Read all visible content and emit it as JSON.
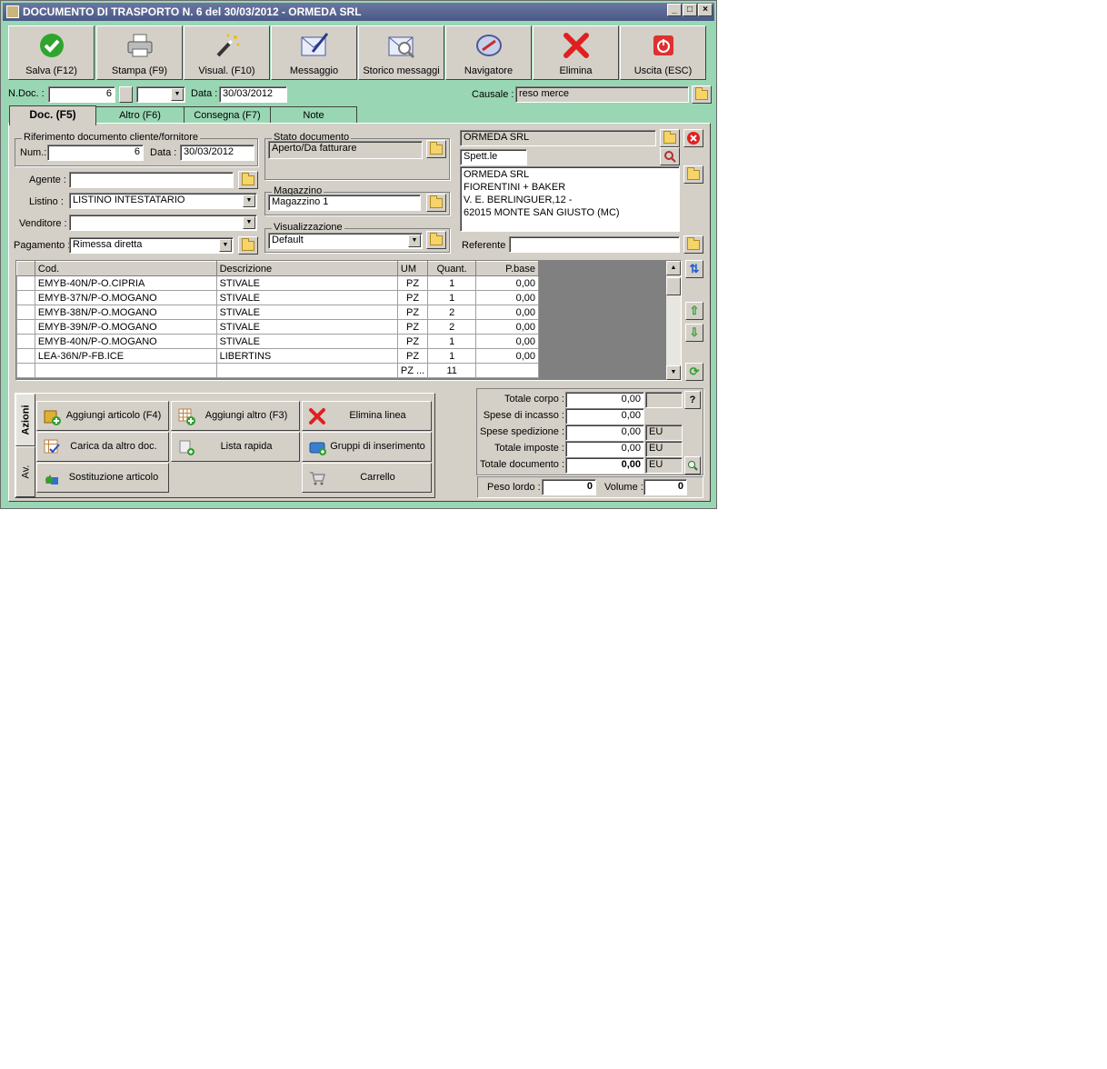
{
  "window": {
    "title": "DOCUMENTO DI TRASPORTO N. 6  del 30/03/2012 - ORMEDA SRL"
  },
  "toolbar": [
    {
      "label": "Salva (F12)",
      "icon": "check-icon"
    },
    {
      "label": "Stampa (F9)",
      "icon": "printer-icon"
    },
    {
      "label": "Visual. (F10)",
      "icon": "magic-wand-icon"
    },
    {
      "label": "Messaggio",
      "icon": "envelope-pen-icon"
    },
    {
      "label": "Storico messaggi",
      "icon": "envelope-search-icon"
    },
    {
      "label": "Navigatore",
      "icon": "compass-icon"
    },
    {
      "label": "Elimina",
      "icon": "red-x-icon"
    },
    {
      "label": "Uscita (ESC)",
      "icon": "power-icon"
    }
  ],
  "header": {
    "ndoc_label": "N.Doc. :",
    "ndoc_value": "6",
    "data_label": "Data :",
    "data_value": "30/03/2012",
    "causale_label": "Causale :",
    "causale_value": "reso merce"
  },
  "tabs": [
    "Doc. (F5)",
    "Altro (F6)",
    "Consegna (F7)",
    "Note"
  ],
  "riferimento": {
    "title": "Riferimento documento cliente/fornitore",
    "num_label": "Num.:",
    "num_value": "6",
    "data_label": "Data :",
    "data_value": "30/03/2012"
  },
  "fields": {
    "agente_label": "Agente :",
    "agente_value": "",
    "listino_label": "Listino :",
    "listino_value": "LISTINO INTESTATARIO",
    "venditore_label": "Venditore :",
    "venditore_value": "",
    "pagamento_label": "Pagamento :",
    "pagamento_value": "Rimessa diretta"
  },
  "stato": {
    "title": "Stato documento",
    "value": "Aperto/Da fatturare"
  },
  "magazzino": {
    "title": "Magazzino",
    "value": "Magazzino 1"
  },
  "visualizzazione": {
    "title": "Visualizzazione",
    "value": "Default"
  },
  "cliente": {
    "name": "ORMEDA SRL",
    "spett": "Spett.le",
    "address": [
      "ORMEDA SRL",
      "FIORENTINI + BAKER",
      "V. E. BERLINGUER,12 -",
      "62015 MONTE SAN  GIUSTO (MC)"
    ],
    "referente_label": "Referente",
    "referente_value": ""
  },
  "grid": {
    "columns": [
      "Cod.",
      "Descrizione",
      "UM",
      "Quant.",
      "P.base"
    ],
    "rows": [
      [
        "EMYB-40N/P-O.CIPRIA",
        "STIVALE",
        "PZ",
        "1",
        "0,00"
      ],
      [
        "EMYB-37N/P-O.MOGANO",
        "STIVALE",
        "PZ",
        "1",
        "0,00"
      ],
      [
        "EMYB-38N/P-O.MOGANO",
        "STIVALE",
        "PZ",
        "2",
        "0,00"
      ],
      [
        "EMYB-39N/P-O.MOGANO",
        "STIVALE",
        "PZ",
        "2",
        "0,00"
      ],
      [
        "EMYB-40N/P-O.MOGANO",
        "STIVALE",
        "PZ",
        "1",
        "0,00"
      ],
      [
        "LEA-36N/P-FB.ICE",
        "LIBERTINS",
        "PZ",
        "1",
        "0,00"
      ]
    ],
    "footer": [
      "",
      "",
      "PZ ...",
      "11",
      ""
    ]
  },
  "actions": {
    "tab_azioni": "Azioni",
    "tab_av": "Av.",
    "buttons": [
      {
        "label": "Aggiungi articolo (F4)",
        "icon": "add-box-icon"
      },
      {
        "label": "Aggiungi altro (F3)",
        "icon": "add-grid-icon"
      },
      {
        "label": "Elimina linea",
        "icon": "red-x-icon"
      },
      {
        "label": "Carica da altro doc.",
        "icon": "load-doc-icon"
      },
      {
        "label": "Lista rapida",
        "icon": "quick-list-icon"
      },
      {
        "label": "Gruppi di inserimento",
        "icon": "group-insert-icon"
      },
      {
        "label": "Sostituzione articolo",
        "icon": "replace-icon"
      },
      {
        "label": "Carrello",
        "icon": "cart-icon"
      }
    ]
  },
  "totals": {
    "corpo_label": "Totale corpo :",
    "corpo_value": "0,00",
    "incasso_label": "Spese di incasso :",
    "incasso_value": "0,00",
    "spedizione_label": "Spese spedizione :",
    "spedizione_value": "0,00",
    "imposte_label": "Totale imposte :",
    "imposte_value": "0,00",
    "documento_label": "Totale documento :",
    "documento_value": "0,00",
    "currency": "EU",
    "help": "?",
    "peso_label": "Peso lordo :",
    "peso_value": "0",
    "volume_label": "Volume :",
    "volume_value": "0"
  }
}
